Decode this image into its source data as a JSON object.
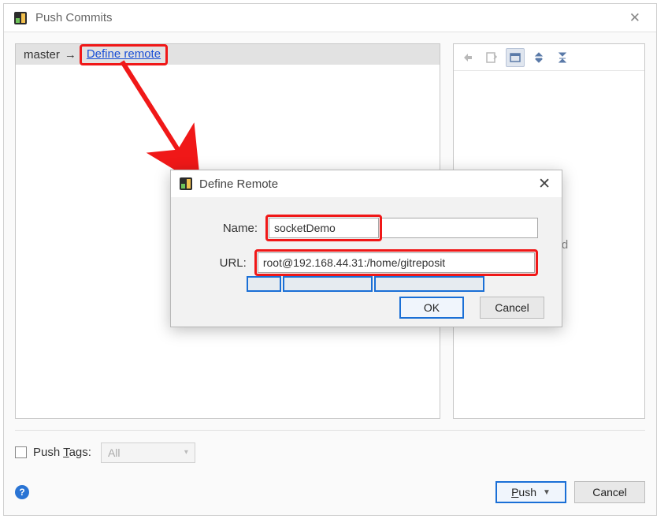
{
  "window": {
    "title": "Push Commits",
    "close_tooltip": "Close"
  },
  "branch": {
    "local": "master",
    "define_remote_label": "Define remote"
  },
  "right": {
    "toolbar": {
      "prev": "prev-change-icon",
      "next": "next-change-icon",
      "expand": "expand-all-icon",
      "collapse_top": "collapse-top-icon",
      "collapse_bottom": "collapse-bottom-icon"
    },
    "no_selection_text": "elected"
  },
  "push_tags": {
    "checkbox_label_prefix": "Push ",
    "checkbox_label_mnemonic": "T",
    "checkbox_label_suffix": "ags:",
    "combo_value": "All"
  },
  "footer": {
    "push_mnemonic": "P",
    "push_rest": "ush",
    "cancel": "Cancel"
  },
  "inner_dialog": {
    "title": "Define Remote",
    "name_label": "Name:",
    "name_value": "socketDemo",
    "url_label": "URL:",
    "url_value": "root@192.168.44.31:/home/gitreposit",
    "ok": "OK",
    "cancel": "Cancel"
  }
}
